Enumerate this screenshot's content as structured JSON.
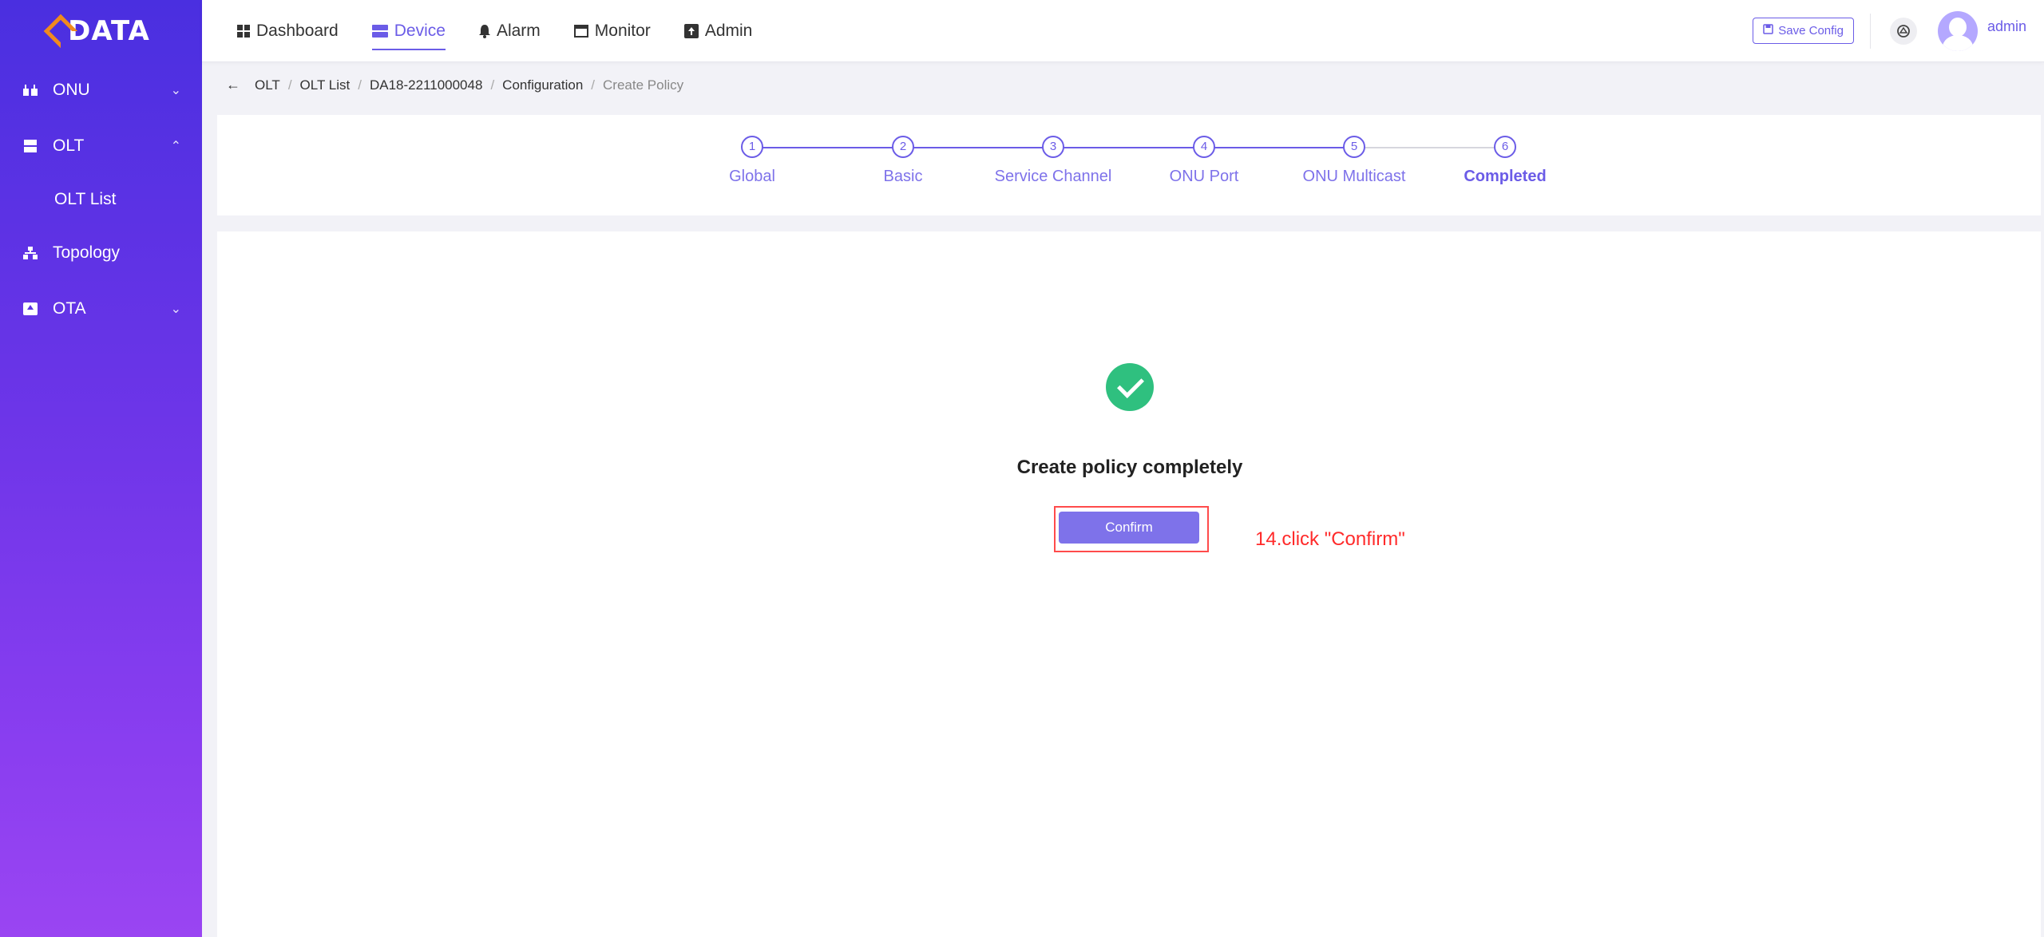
{
  "brand": {
    "logo_text": "DATA"
  },
  "sidebar": {
    "items": [
      {
        "label": "ONU",
        "icon": "onu-icon",
        "chevron": "⌄"
      },
      {
        "label": "OLT",
        "icon": "olt-icon",
        "chevron": "⌃"
      },
      {
        "label": "OLT List"
      },
      {
        "label": "Topology",
        "icon": "topology-icon"
      },
      {
        "label": "OTA",
        "icon": "ota-icon",
        "chevron": "⌄"
      }
    ]
  },
  "topnav": {
    "tabs": [
      {
        "label": "Dashboard",
        "icon": "dashboard-icon"
      },
      {
        "label": "Device",
        "icon": "device-icon",
        "active": true
      },
      {
        "label": "Alarm",
        "icon": "alarm-icon"
      },
      {
        "label": "Monitor",
        "icon": "monitor-icon"
      },
      {
        "label": "Admin",
        "icon": "admin-icon"
      }
    ],
    "save_config": "Save Config",
    "user": "admin"
  },
  "breadcrumb": {
    "back": "←",
    "items": [
      "OLT",
      "OLT List",
      "DA18-2211000048",
      "Configuration",
      "Create Policy"
    ],
    "separator": "/"
  },
  "steps": [
    {
      "num": "1",
      "label": "Global"
    },
    {
      "num": "2",
      "label": "Basic"
    },
    {
      "num": "3",
      "label": "Service Channel"
    },
    {
      "num": "4",
      "label": "ONU Port"
    },
    {
      "num": "5",
      "label": "ONU Multicast"
    },
    {
      "num": "6",
      "label": "Completed",
      "current": true
    }
  ],
  "result": {
    "title": "Create policy completely",
    "confirm": "Confirm"
  },
  "annotation": "14.click \"Confirm\"",
  "colors": {
    "accent": "#6b5ce7",
    "button": "#7e72ea",
    "success": "#2fc07f",
    "annotation": "#ff2a2a"
  }
}
